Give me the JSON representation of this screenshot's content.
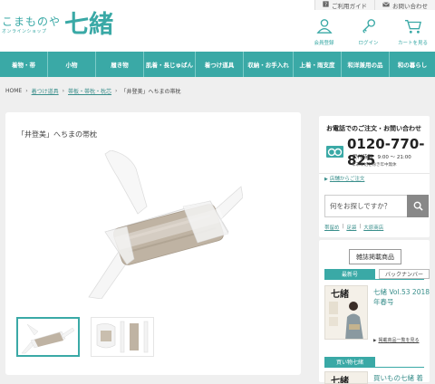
{
  "logo": {
    "main": "こまものや",
    "sub": "オンラインショップ",
    "kanji": "七緒"
  },
  "topnav": [
    {
      "icon": "question-icon",
      "label": "ご利用ガイド"
    },
    {
      "icon": "mail-icon",
      "label": "お問い合わせ"
    }
  ],
  "iconnav": [
    {
      "icon": "member-icon",
      "label": "会員登録"
    },
    {
      "icon": "key-icon",
      "label": "ログイン"
    },
    {
      "icon": "cart-icon",
      "label": "カートを見る"
    }
  ],
  "categories": [
    "着物・帯",
    "小物",
    "履き物",
    "肌着・長じゅばん",
    "着つけ道具",
    "収納・お手入れ",
    "上着・雨支度",
    "和洋兼用の品",
    "和の暮らし"
  ],
  "breadcrumb": {
    "home": "HOME",
    "level1": "着つけ道具",
    "level2": "帯板・帯枕・枕芯",
    "current": "「井登美」へちまの帯枕"
  },
  "product": {
    "title": "「井登美」へちまの帯枕"
  },
  "contact": {
    "title": "お電話でのご注文・お問い合わせ",
    "phone": "0120-770-825",
    "hours": "受付時間　9:00 ～ 21:00",
    "note": "年末年始を除き年中無休"
  },
  "shop_link": "店舗からご注文",
  "search": {
    "placeholder": "何をお探しですか？",
    "tags": [
      "帯留め",
      "足袋",
      "大原商店"
    ]
  },
  "magazine": {
    "head": "雑誌掲載商品",
    "tabs": [
      "最新号",
      "バックナンバー"
    ],
    "title": "七緒 Vol.53 2018 年春号",
    "list_link": "掲載商品一覧を見る",
    "cover_kanji": "七緒"
  },
  "shopping": {
    "tab": "買い物七緒",
    "title": "買いもの七緒 着",
    "cover_kanji": "七緒"
  },
  "colors": {
    "accent": "#3aa9a6",
    "link": "#3a8f8c"
  }
}
